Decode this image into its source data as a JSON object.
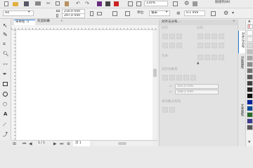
{
  "menu": {
    "window_settings_label": "链排列(W)"
  },
  "toolbar": {
    "zoom_value": "135%",
    "units_label": "单位:",
    "units_value": "毫米",
    "nudge_value": "0.1 mm",
    "page_size": "A4",
    "width_value": "210.0 mm",
    "height_value": "297.0 mm"
  },
  "tabs": {
    "doc_tab_label": "未命名 -1",
    "welcome_tab_label": "欢迎屏幕",
    "add_tab_symbol": "+"
  },
  "docker": {
    "title": "对齐与分布...",
    "align_label": "对齐",
    "distribute_label": "分布",
    "text_label": "文本",
    "align_to_label": "对齐对象到",
    "x_value": "105.0 mm",
    "y_value": "148.5 mm",
    "distribute_to_label": "将对象分布到",
    "side_tab_1": "对齐与分布",
    "side_tab_2": "对象属性",
    "side_tab_3": "文本属性"
  },
  "statusbar": {
    "page_info": "1 / 1",
    "page_tab": "页 1"
  },
  "palette_colors": [
    "#ffffff",
    "#f2f2f2",
    "#d9d9d9",
    "#bfbfbf",
    "#a6a6a6",
    "#8c8c8c",
    "#737373",
    "#595959",
    "#404040",
    "#262626",
    "#0c0c0c",
    "#00209b",
    "#0b4a9a",
    "#2a6a2a",
    "#3b3b8f",
    "#5a5a5a"
  ],
  "colors": {
    "accent": "#2a7fd4",
    "canvas": "#ffffff",
    "chrome": "#e9e9ea"
  }
}
